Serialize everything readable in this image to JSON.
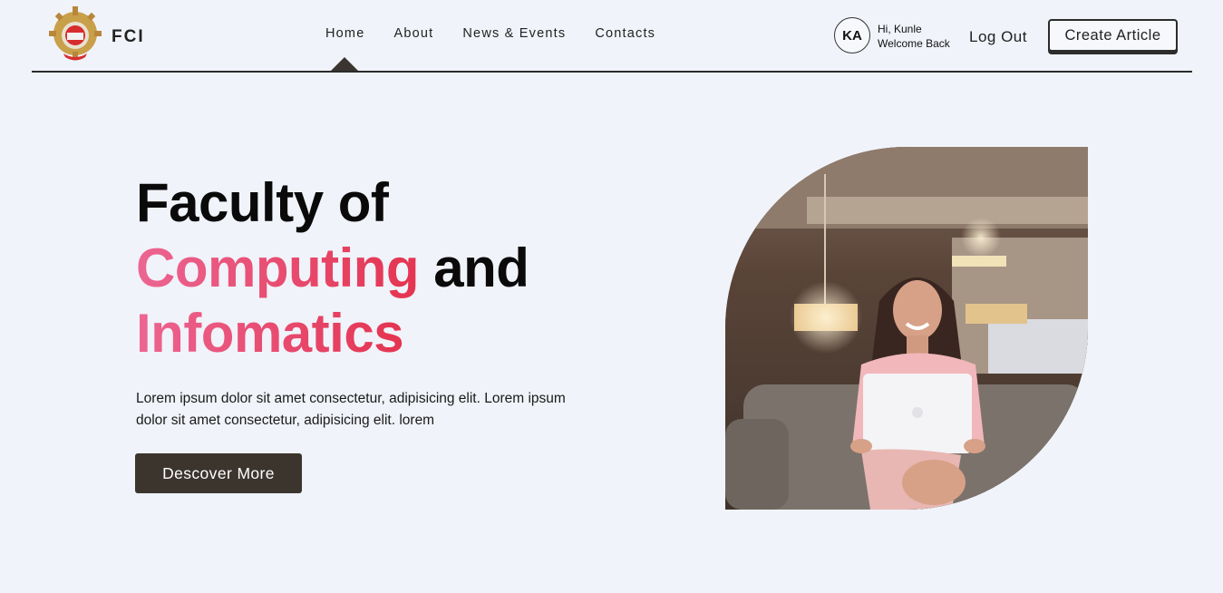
{
  "header": {
    "brand": "FCI",
    "nav": [
      {
        "label": "Home",
        "active": true
      },
      {
        "label": "About"
      },
      {
        "label": "News & Events"
      },
      {
        "label": "Contacts"
      }
    ],
    "user": {
      "initials": "KA",
      "greeting": "Hi, Kunle",
      "subtitle": "Welcome Back"
    },
    "logout_label": "Log Out",
    "create_label": "Create Article"
  },
  "hero": {
    "title_line1": "Faculty of",
    "title_highlight1": "Computing",
    "title_connector": " and",
    "title_highlight2": "Infomatics",
    "description": "Lorem ipsum dolor sit amet consectetur, adipisicing elit. Lorem ipsum dolor sit amet consectetur, adipisicing elit. lorem",
    "cta_label": "Descover More"
  },
  "colors": {
    "background": "#f0f3f9",
    "accent_start": "#ec6592",
    "accent_end": "#e43450",
    "button_dark": "#3c352d"
  }
}
